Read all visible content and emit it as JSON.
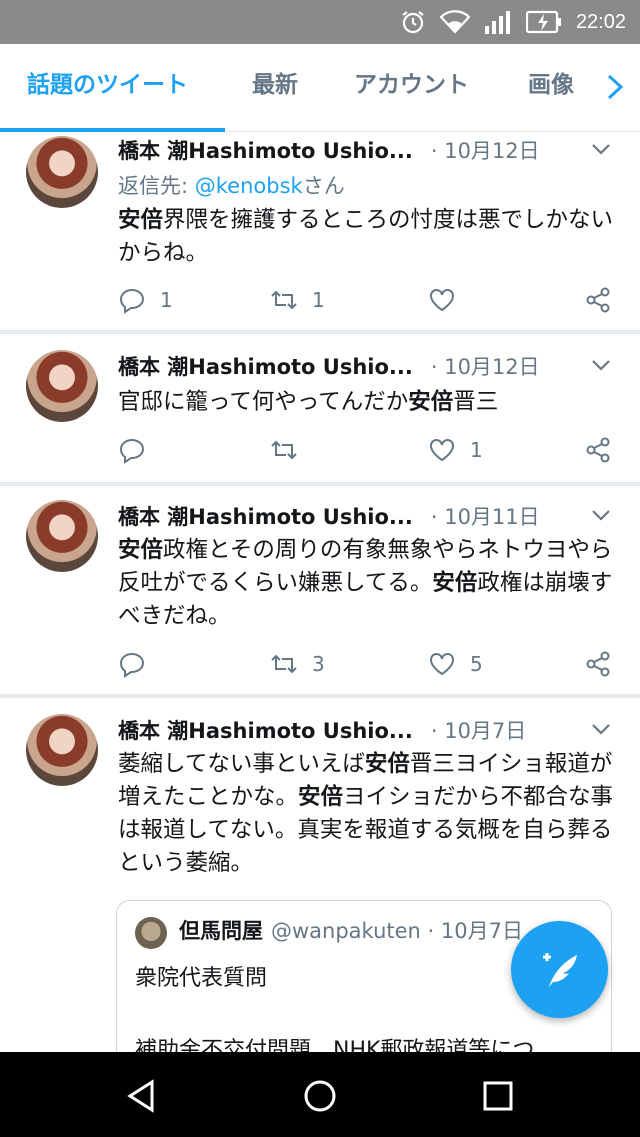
{
  "status_bar": {
    "time": "22:02",
    "icons": [
      "alarm-icon",
      "wifi-icon",
      "signal-icon",
      "battery-charging-icon"
    ]
  },
  "tabs": [
    {
      "label": "話題のツイート",
      "active": true
    },
    {
      "label": "最新",
      "active": false
    },
    {
      "label": "アカウント",
      "active": false
    },
    {
      "label": "画像",
      "active": false
    }
  ],
  "tweets": [
    {
      "name": "橋本 潮Hashimoto Ushio...",
      "date": "· 10月12日",
      "reply_prefix": "返信先: ",
      "reply_handle": "@kenobsk",
      "reply_suffix": "さん",
      "text_segments": [
        {
          "t": "安倍",
          "bold": true
        },
        {
          "t": "界隈を擁護するところの忖度は悪でしかないからね。",
          "bold": false
        }
      ],
      "replies": "1",
      "retweets": "1",
      "likes": ""
    },
    {
      "name": "橋本 潮Hashimoto Ushio...",
      "date": "· 10月12日",
      "text_segments": [
        {
          "t": "官邸に籠って何やってんだか",
          "bold": false
        },
        {
          "t": "安倍",
          "bold": true
        },
        {
          "t": "晋三",
          "bold": false
        }
      ],
      "replies": "",
      "retweets": "",
      "likes": "1"
    },
    {
      "name": "橋本 潮Hashimoto Ushio...",
      "date": "· 10月11日",
      "text_segments": [
        {
          "t": "安倍",
          "bold": true
        },
        {
          "t": "政権とその周りの有象無象やらネトウヨやら反吐がでるくらい嫌悪してる。",
          "bold": false
        },
        {
          "t": "安倍",
          "bold": true
        },
        {
          "t": "政権は崩壊すべきだね。",
          "bold": false
        }
      ],
      "replies": "",
      "retweets": "3",
      "likes": "5"
    },
    {
      "name": "橋本 潮Hashimoto Ushio...",
      "date": "· 10月7日",
      "text_segments": [
        {
          "t": "萎縮してない事といえば",
          "bold": false
        },
        {
          "t": "安倍",
          "bold": true
        },
        {
          "t": "晋三ヨイショ報道が増えたことかな。",
          "bold": false
        },
        {
          "t": "安倍",
          "bold": true
        },
        {
          "t": "ヨイショだから不都合な事は報道してない。真実を報道する気概を自ら葬るという萎縮。",
          "bold": false
        }
      ],
      "quote": {
        "name": "但馬問屋",
        "meta": "@wanpakuten · 10月7日",
        "lines": [
          "衆院代表質問",
          "",
          "補助金不交付問題、NHK郵政報道等につ"
        ]
      }
    }
  ],
  "fab": {
    "icon": "compose-tweet-icon"
  },
  "nav": {
    "icons": [
      "back-icon",
      "home-icon",
      "recents-icon"
    ]
  }
}
